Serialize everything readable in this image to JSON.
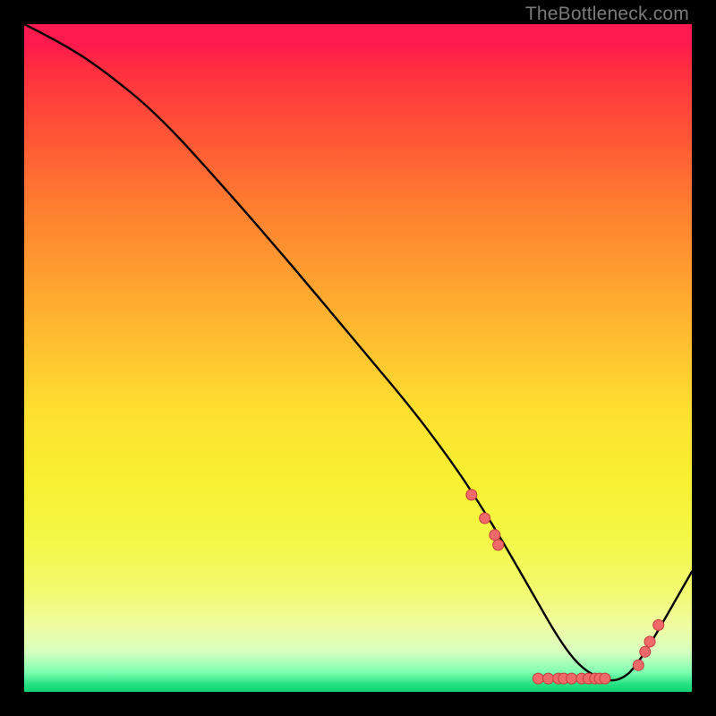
{
  "attribution": "TheBottleneck.com",
  "colors": {
    "background": "#000000",
    "curve": "#000000",
    "marker_fill": "#f06a6a",
    "marker_stroke": "#c73c3c"
  },
  "chart_data": {
    "type": "line",
    "title": "",
    "xlabel": "",
    "ylabel": "",
    "xlim": [
      0,
      100
    ],
    "ylim": [
      0,
      100
    ],
    "series": [
      {
        "name": "bottleneck-curve",
        "x": [
          0,
          6,
          12,
          20,
          30,
          40,
          50,
          58,
          64,
          68,
          72,
          76,
          80,
          83,
          86,
          89,
          92,
          100
        ],
        "values": [
          100,
          97,
          93,
          86.5,
          75.5,
          64,
          52,
          42.5,
          34.5,
          28.5,
          22,
          15,
          8,
          4,
          2,
          1.5,
          4,
          18
        ]
      }
    ],
    "markers": [
      {
        "x": 67,
        "y": 29.5
      },
      {
        "x": 69,
        "y": 26
      },
      {
        "x": 70.5,
        "y": 23.5
      },
      {
        "x": 71,
        "y": 22
      },
      {
        "x": 77,
        "y": 2
      },
      {
        "x": 78.5,
        "y": 2
      },
      {
        "x": 80,
        "y": 2
      },
      {
        "x": 80.8,
        "y": 2
      },
      {
        "x": 82,
        "y": 2
      },
      {
        "x": 83.5,
        "y": 2
      },
      {
        "x": 84.5,
        "y": 2
      },
      {
        "x": 85.5,
        "y": 2
      },
      {
        "x": 86.2,
        "y": 2
      },
      {
        "x": 87,
        "y": 2
      },
      {
        "x": 92,
        "y": 4
      },
      {
        "x": 93,
        "y": 6
      },
      {
        "x": 93.7,
        "y": 7.5
      },
      {
        "x": 95,
        "y": 10
      }
    ]
  }
}
